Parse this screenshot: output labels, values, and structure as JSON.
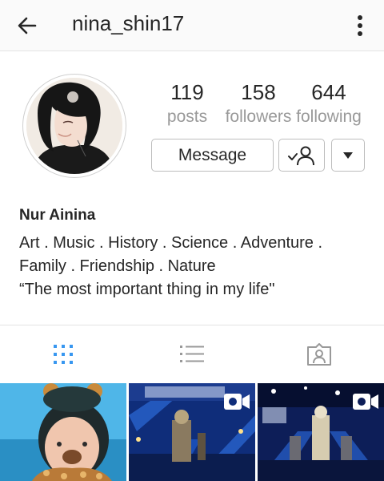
{
  "header": {
    "username": "nina_shin17",
    "back_icon": "arrow-left-icon",
    "more_icon": "kebab-menu-icon"
  },
  "profile": {
    "avatar_icon": "avatar-photo",
    "stats": {
      "posts": {
        "count": "119",
        "label": "posts"
      },
      "followers": {
        "count": "158",
        "label": "followers"
      },
      "following": {
        "count": "644",
        "label": "following"
      }
    },
    "actions": {
      "message_label": "Message",
      "following_icon": "user-check-icon",
      "dropdown_icon": "caret-down-icon"
    },
    "full_name": "Nur Ainina",
    "bio_lines": [
      "Art . Music . History . Science . Adventure .",
      "Family . Friendship . Nature",
      "“The most important thing in my life\""
    ]
  },
  "tabs": [
    {
      "icon": "grid-icon",
      "active": true
    },
    {
      "icon": "list-icon",
      "active": false
    },
    {
      "icon": "tagged-person-icon",
      "active": false
    }
  ],
  "posts": [
    {
      "kind": "photo"
    },
    {
      "kind": "video",
      "badge_icon": "video-camera-icon"
    },
    {
      "kind": "video",
      "badge_icon": "video-camera-icon"
    }
  ],
  "colors": {
    "active_tab": "#3897f0",
    "inactive_tab": "#999999",
    "text": "#262626",
    "muted": "#999999",
    "stage_blue": "#1f4fb8"
  }
}
